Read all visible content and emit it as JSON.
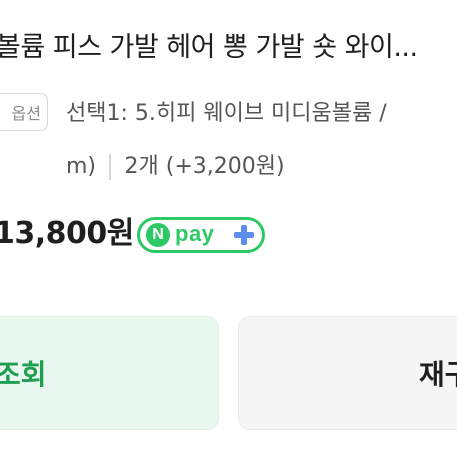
{
  "product": {
    "title": "볼륨 피스 가발 헤어 뽕 가발 숏 와이..."
  },
  "option": {
    "badge_label": "옵션",
    "line1": "선택1: 5.히피 웨이브 미디움볼륨 /",
    "line2_text": "m)",
    "quantity": "2개",
    "extra_price": "(+3,200원)"
  },
  "price": {
    "amount": "13,800원"
  },
  "npay": {
    "logo_letter": "N",
    "label": "pay"
  },
  "buttons": {
    "left_label": "조회",
    "right_label": "재구"
  },
  "colors": {
    "npay_green": "#2ec865",
    "npay_plus_blue": "#5a8dee",
    "left_button_bg": "#e9f8ee",
    "left_button_text": "#1f9e52",
    "right_button_bg": "#f5f5f5"
  }
}
